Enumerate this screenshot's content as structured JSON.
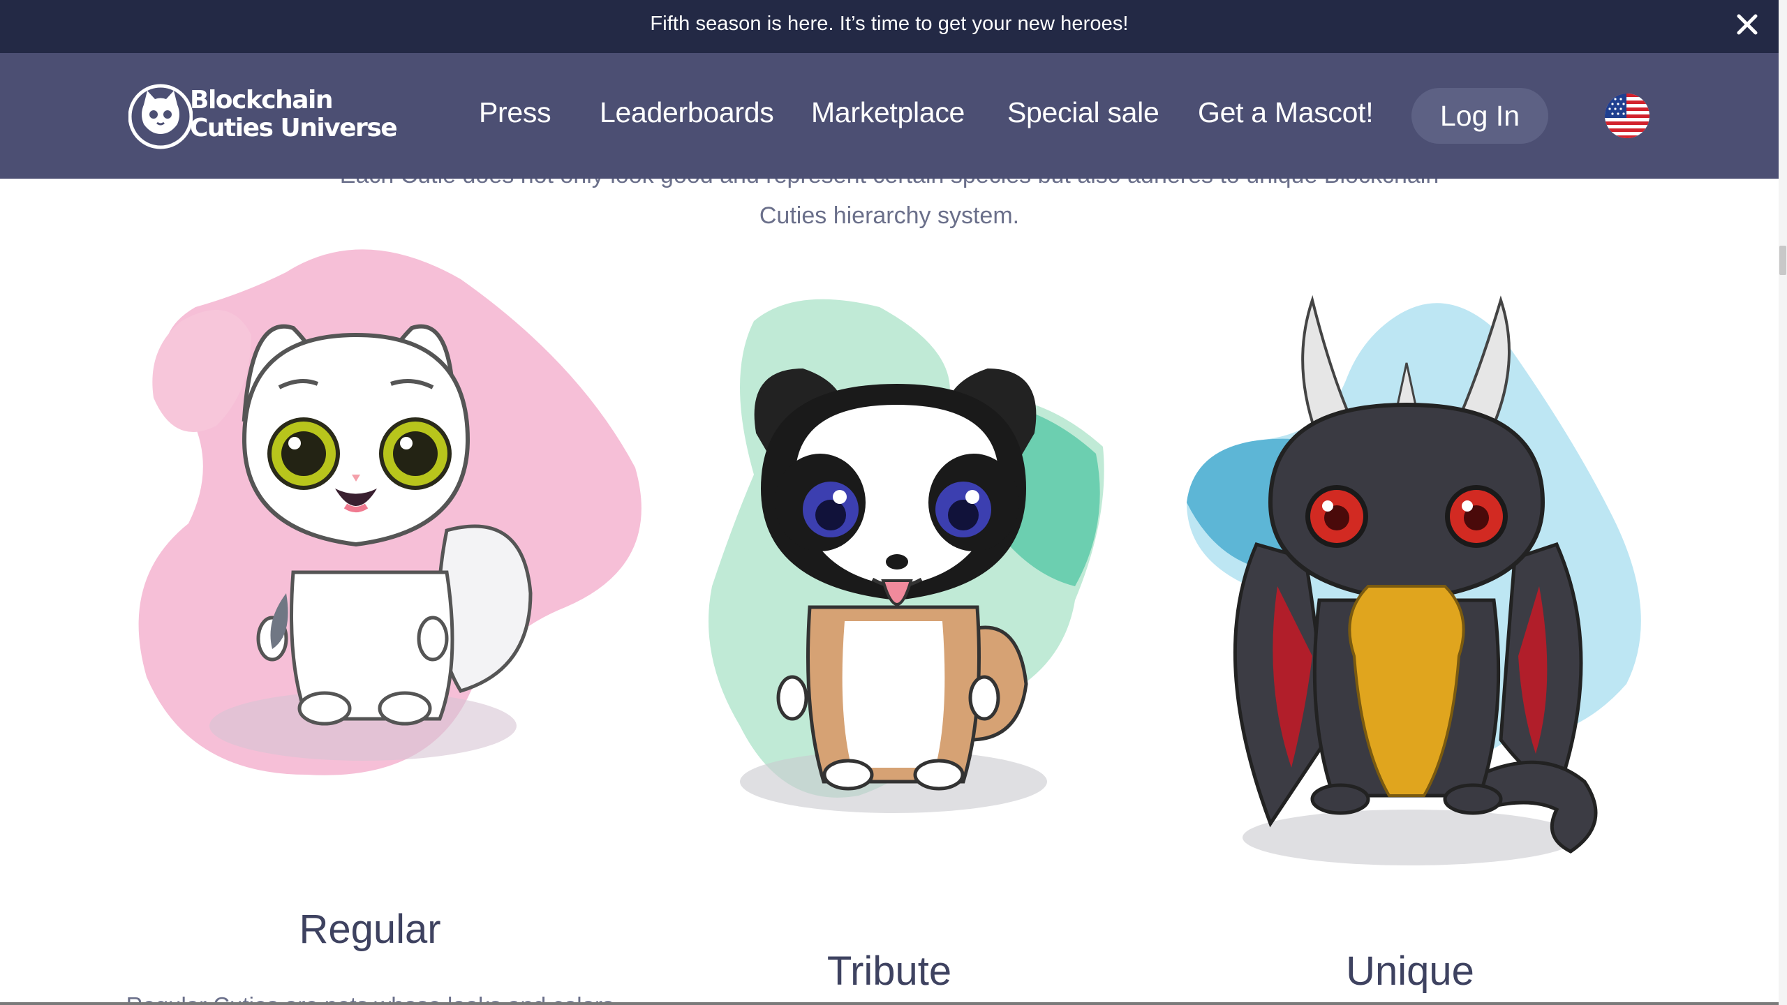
{
  "announcement": {
    "text": "Fifth season is here. It’s time to get your new heroes!",
    "close_icon": "close-icon"
  },
  "header": {
    "logo_line1": "Blockchain",
    "logo_line2": "Cuties Universe",
    "nav": [
      {
        "label": "Press"
      },
      {
        "label": "Leaderboards"
      },
      {
        "label": "Marketplace"
      },
      {
        "label": "Special sale"
      },
      {
        "label": "Get a Mascot!"
      }
    ],
    "login_label": "Log In",
    "language_icon": "us-flag-icon"
  },
  "intro": {
    "line1": "Each Cutie does not only look good and represent certain species but also adheres to unique Blockchain",
    "line2": "Cuties hierarchy system."
  },
  "cards": [
    {
      "title": "Regular",
      "description": "Regular Cuties are pets whose looks and colors"
    },
    {
      "title": "Tribute",
      "description": ""
    },
    {
      "title": "Unique",
      "description": ""
    }
  ],
  "colors": {
    "announcement_bg": "#232945",
    "header_bg": "#4c4f73",
    "login_bg": "#5d6184",
    "title_text": "#3e4260",
    "body_text": "#6a6f8a",
    "regular_blob": "#f6bcd5",
    "tribute_blob": "#8fdcc0",
    "unique_blob": "#8cd0ea"
  }
}
